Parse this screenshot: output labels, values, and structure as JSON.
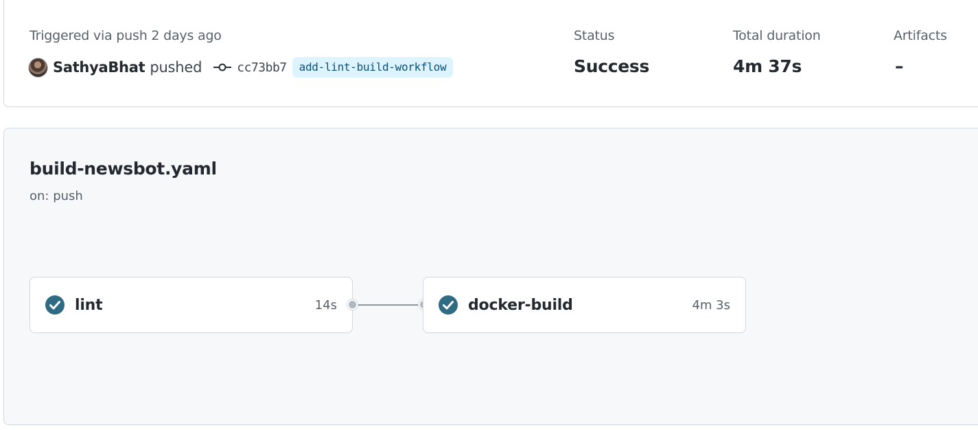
{
  "run_summary": {
    "trigger_text": "Triggered via push 2 days ago",
    "actor": "SathyaBhat",
    "action": "pushed",
    "commit_sha": "cc73bb7",
    "branch": "add-lint-build-workflow",
    "status_label": "Status",
    "status_value": "Success",
    "duration_label": "Total duration",
    "duration_value": "4m 37s",
    "artifacts_label": "Artifacts",
    "artifacts_value": "–"
  },
  "workflow": {
    "file_name": "build-newsbot.yaml",
    "trigger": "on: push",
    "jobs": [
      {
        "name": "lint",
        "duration": "14s",
        "status": "success"
      },
      {
        "name": "docker-build",
        "duration": "4m 3s",
        "status": "success"
      }
    ]
  },
  "colors": {
    "success_icon": "#2f6c84",
    "branch_badge_bg": "#ddf4ff",
    "panel_bg": "#f6f8fa",
    "border": "#d0d7de"
  },
  "icons": {
    "commit": "git-commit-icon",
    "job_status": "check-circle-icon"
  }
}
